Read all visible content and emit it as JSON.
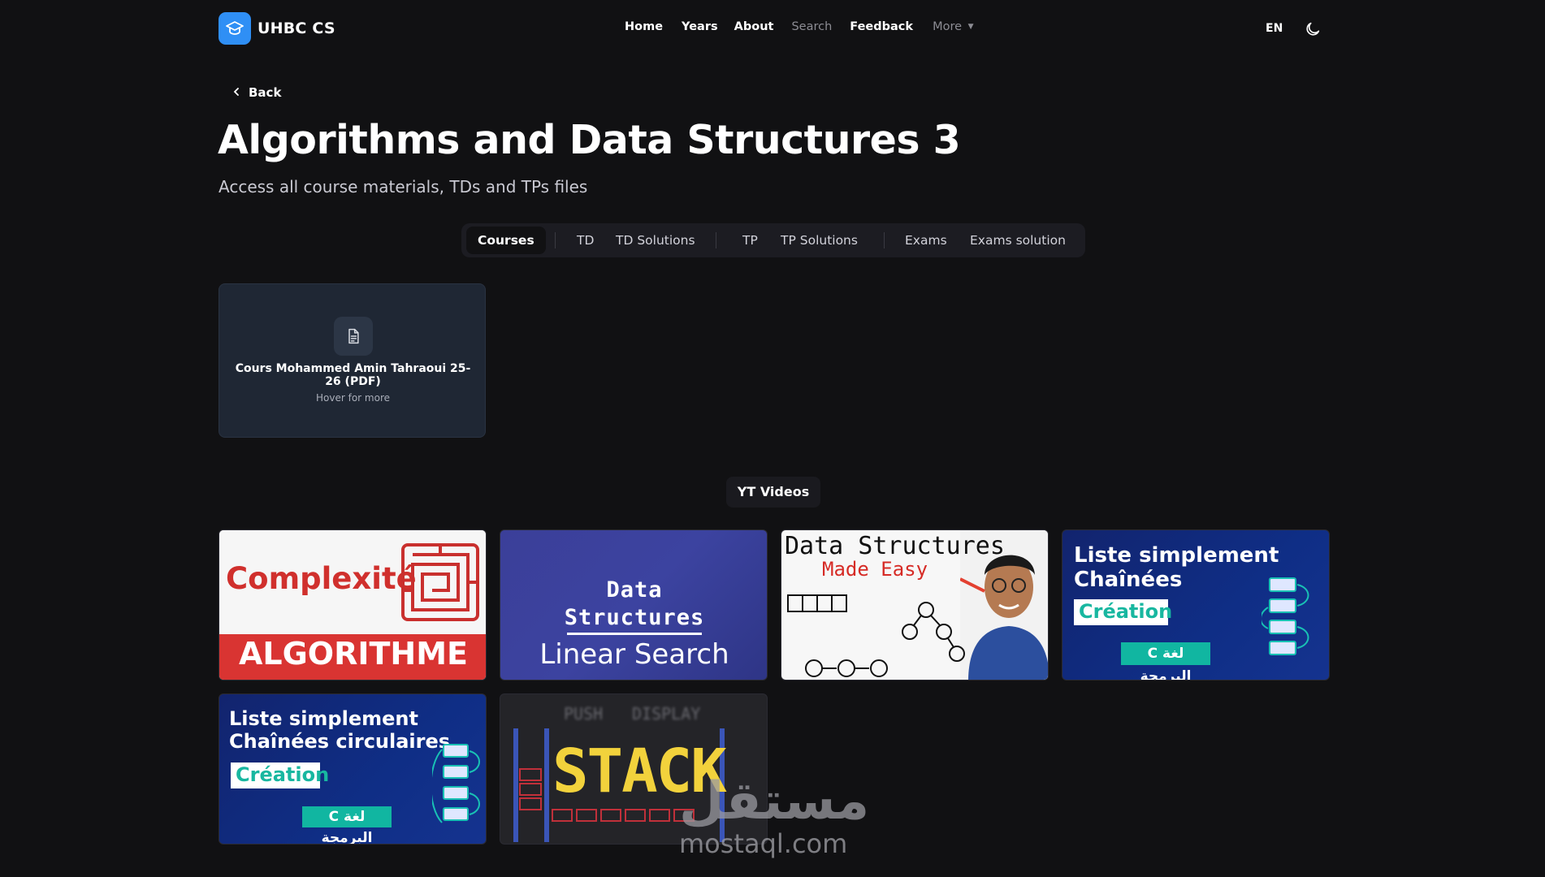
{
  "nav": {
    "brand": "UHBC CS",
    "links": [
      "Home",
      "Years",
      "About",
      "Search",
      "Feedback",
      "More"
    ],
    "lang": "EN"
  },
  "page": {
    "back_label": "Back",
    "title": "Algorithms and Data Structures 3",
    "subtitle": "Access all course materials, TDs and TPs files"
  },
  "tabs": [
    "Courses",
    "TD",
    "TD Solutions",
    "TP",
    "TP Solutions",
    "Exams",
    "Exams solution"
  ],
  "course_card": {
    "title": "Cours Mohammed Amin Tahraoui 25-26 (PDF)",
    "hint": "Hover for more"
  },
  "yt_label": "YT Videos",
  "videos": [
    {
      "line1": "Complexité",
      "line2": "ALGORITHME"
    },
    {
      "line1": "Data",
      "line2": "Structures",
      "line3": "Linear Search"
    },
    {
      "line1": "Data Structures",
      "line2": "Made Easy"
    },
    {
      "line1": "Liste simplement",
      "line2": "Chaînées",
      "badge": "Création",
      "arabic": "C لغة البرمجة"
    },
    {
      "line1": "Liste simplement",
      "line2": "Chaînées circulaires",
      "badge": "Création",
      "arabic": "C لغة البرمجة"
    },
    {
      "line1": "PUSH",
      "line2": "DISPLAY",
      "line3": "STACK"
    }
  ],
  "watermark": {
    "arabic": "مستقل",
    "latin": "mostaql.com"
  },
  "colors": {
    "background": "#111113",
    "brand": "#2f8ff5",
    "card": "#1f2734",
    "tab_bg": "#1c1c22"
  }
}
